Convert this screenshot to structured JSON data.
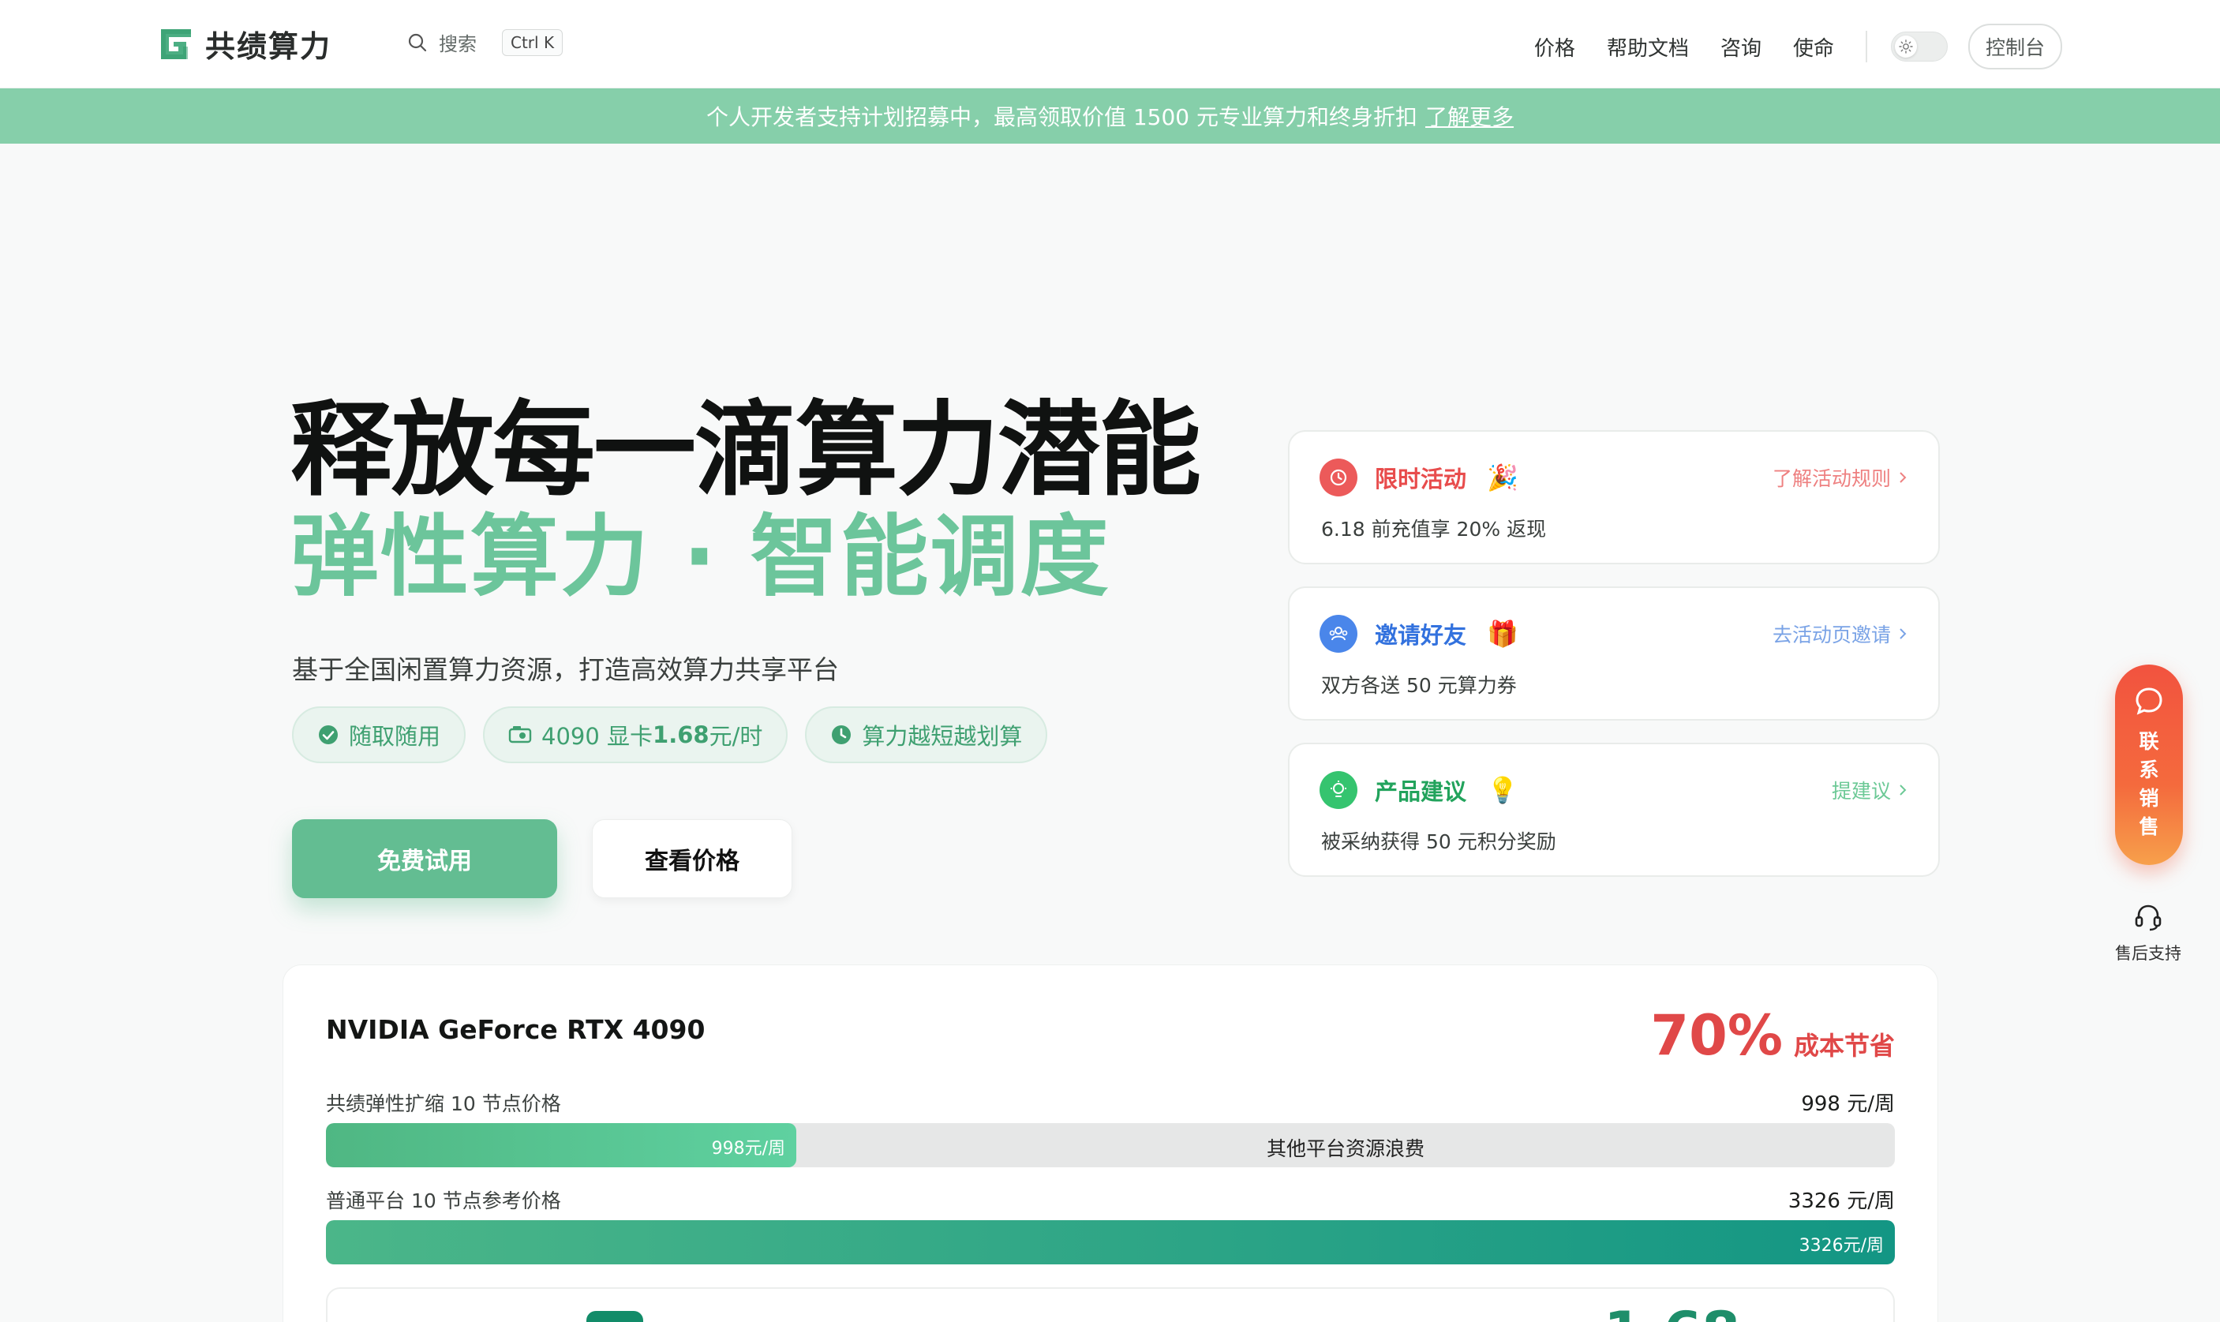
{
  "header": {
    "logo_text": "共绩算力",
    "search_label": "搜索",
    "search_shortcut": "Ctrl K",
    "nav": [
      "价格",
      "帮助文档",
      "咨询",
      "使命"
    ],
    "console_label": "控制台"
  },
  "banner": {
    "text": "个人开发者支持计划招募中，最高领取价值 1500 元专业算力和终身折扣",
    "link": "了解更多"
  },
  "hero": {
    "title": "释放每一滴算力潜能",
    "subtitle": "弹性算力 · 智能调度",
    "description": "基于全国闲置算力资源，打造高效算力共享平台",
    "features": [
      {
        "label": "随取随用",
        "icon": "check-circle-icon"
      },
      {
        "label_prefix": "4090 显卡",
        "label_bold": "1.68",
        "label_suffix": "元/时",
        "icon": "gpu-icon"
      },
      {
        "label": "算力越短越划算",
        "icon": "clock-icon"
      }
    ],
    "primary_cta": "免费试用",
    "secondary_cta": "查看价格"
  },
  "promos": [
    {
      "title": "限时活动",
      "emoji": "🎉",
      "link": "了解活动规则",
      "desc": "6.18 前充值享 20% 返现",
      "color": "#e84c4c",
      "icon": "clock-icon"
    },
    {
      "title": "邀请好友",
      "emoji": "🎁",
      "link": "去活动页邀请",
      "desc": "双方各送 50 元算力券",
      "color": "#3f7be0",
      "icon": "users-icon"
    },
    {
      "title": "产品建议",
      "emoji": "💡",
      "link": "提建议",
      "desc": "被采纳获得 50 元积分奖励",
      "color": "#2fb36c",
      "icon": "bulb-icon"
    }
  ],
  "floating": {
    "sales_label": "联系销售",
    "support_label": "售后支持"
  },
  "comparison": {
    "gpu": "NVIDIA GeForce RTX 4090",
    "saving_value": "70%",
    "saving_label": "成本节省",
    "rows": [
      {
        "label": "共绩弹性扩缩 10 节点价格",
        "value": "998 元/周",
        "bar_text": "998元/周",
        "fraction": 0.3,
        "waste_label": "其他平台资源浪费"
      },
      {
        "label": "普通平台 10 节点参考价格",
        "value": "3326 元/周",
        "bar_text": "3326元/周",
        "fraction": 1.0
      }
    ]
  }
}
